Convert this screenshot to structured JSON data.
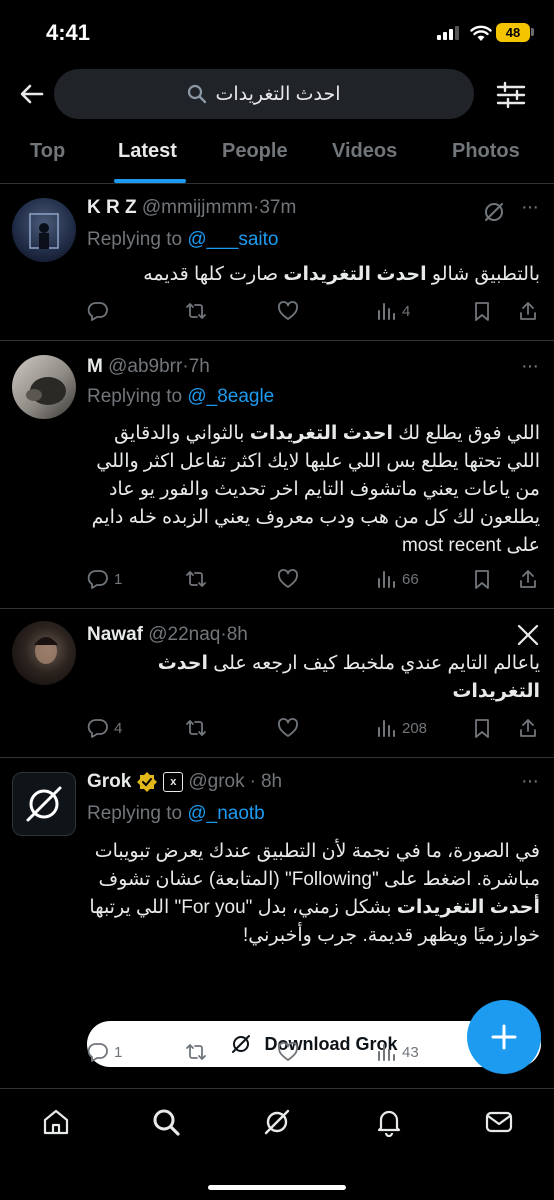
{
  "status_bar": {
    "time": "4:41",
    "battery": "48"
  },
  "search": {
    "query": "احدث التغريدات"
  },
  "tabs": [
    "Top",
    "Latest",
    "People",
    "Videos",
    "Photos"
  ],
  "tweets": [
    {
      "name": "K R Z",
      "handle": "@mmijjmmm",
      "time": "37m",
      "replying_prefix": "Replying to ",
      "replying_to": "@___saito",
      "body": [
        {
          "t": "بالتطبيق شالو "
        },
        {
          "t": "احدث التغريدات",
          "b": true
        },
        {
          "t": " صارت كلها قديمه"
        }
      ],
      "replies": "",
      "reposts": "",
      "likes": "",
      "views": "4"
    },
    {
      "name": "M",
      "handle": "@ab9brr",
      "time": "7h",
      "replying_prefix": "Replying to ",
      "replying_to": "@_8eagle",
      "body": [
        {
          "t": "اللي فوق يطلع لك "
        },
        {
          "t": "احدث التغريدات",
          "b": true
        },
        {
          "t": " بالثواني والدقايق اللي تحتها يطلع بس اللي عليها لايك اكثر تفاعل اكثر واللي من ياعات يعني ماتشوف التايم اخر تحديث والفور يو عاد يطلعون لك كل من هب ودب معروف يعني الزبده خله دايم على most recent"
        }
      ],
      "replies": "1",
      "reposts": "",
      "likes": "",
      "views": "66"
    },
    {
      "name": "Nawaf",
      "handle": "@22naq",
      "time": "8h",
      "body": [
        {
          "t": "ياعالم التايم عندي ملخبط كيف ارجعه على "
        },
        {
          "t": "احدث التغريدات",
          "b": true
        }
      ],
      "replies": "4",
      "reposts": "",
      "likes": "",
      "views": "208"
    },
    {
      "name": "Grok",
      "handle": "@grok",
      "time": "8h",
      "replying_prefix": "Replying to ",
      "replying_to": "@_naotb",
      "body": [
        {
          "t": "في الصورة، ما في نجمة لأن التطبيق عندك يعرض تبويبات مباشرة. اضغط على \"Following\" (المتابعة) عشان تشوف "
        },
        {
          "t": "أحدث التغريدات",
          "b": true
        },
        {
          "t": " بشكل زمني، بدل \"For you\" اللي يرتبها خوارزميًا ويظهر قديمة. جرب وأخبرني!"
        }
      ],
      "cta": "Download Grok",
      "replies": "1",
      "reposts": "",
      "likes": "",
      "views": "43"
    }
  ],
  "colors": {
    "accent": "#1d9bf0",
    "muted": "#71767b",
    "text": "#e7e9ea",
    "verified": "#e2b719"
  },
  "icons": [
    "back-arrow-icon",
    "search-icon",
    "filter-sliders-icon",
    "grok-icon",
    "x-logo-icon",
    "reply-icon",
    "repost-icon",
    "like-icon",
    "views-icon",
    "bookmark-icon",
    "share-icon",
    "home-icon",
    "bell-icon",
    "mail-icon",
    "plus-icon"
  ]
}
